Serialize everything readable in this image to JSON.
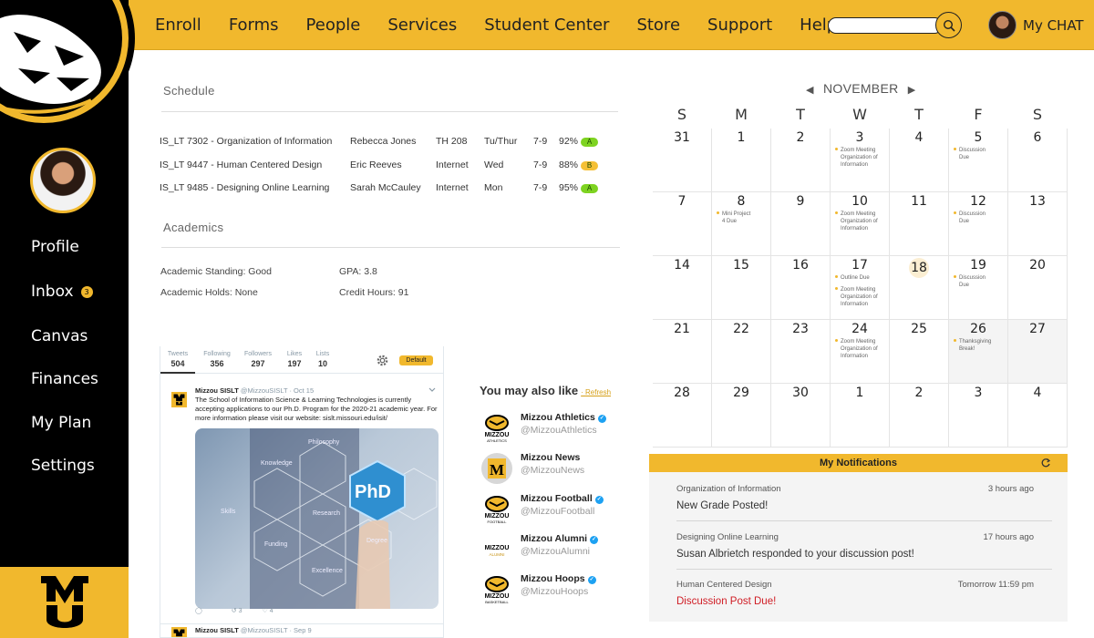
{
  "colors": {
    "gold": "#F1B82D",
    "black": "#000000",
    "alert": "#d01d25",
    "grade_a": "#7ed321",
    "grade_b": "#f5a623"
  },
  "topnav": {
    "items": [
      "Enroll",
      "Forms",
      "People",
      "Services",
      "Student Center",
      "Store",
      "Support",
      "Help"
    ],
    "search_placeholder": "",
    "chat_label": "My CHAT"
  },
  "sidebar": {
    "items": [
      {
        "label": "Profile"
      },
      {
        "label": "Inbox",
        "badge": "3"
      },
      {
        "label": "Canvas"
      },
      {
        "label": "Finances"
      },
      {
        "label": "My Plan"
      },
      {
        "label": "Settings"
      }
    ]
  },
  "schedule": {
    "title": "Schedule",
    "rows": [
      {
        "course": "IS_LT 7302 - Organization of Information",
        "instructor": "Rebecca Jones",
        "room": "TH 208",
        "days": "Tu/Thur",
        "time": "7-9",
        "percent": "92%",
        "grade": "A"
      },
      {
        "course": "IS_LT 9447 - Human Centered Design",
        "instructor": "Eric Reeves",
        "room": "Internet",
        "days": "Wed",
        "time": "7-9",
        "percent": "88%",
        "grade": "B"
      },
      {
        "course": "IS_LT 9485 - Designing Online Learning",
        "instructor": "Sarah McCauley",
        "room": "Internet",
        "days": "Mon",
        "time": "7-9",
        "percent": "95%",
        "grade": "A"
      }
    ]
  },
  "academics": {
    "title": "Academics",
    "standing": "Academic Standing: Good",
    "gpa": "GPA: 3.8",
    "holds": "Academic Holds: None",
    "credit_hours": "Credit Hours: 91"
  },
  "twitter": {
    "stats": [
      {
        "label": "Tweets",
        "value": "504"
      },
      {
        "label": "Following",
        "value": "356"
      },
      {
        "label": "Followers",
        "value": "297"
      },
      {
        "label": "Likes",
        "value": "197"
      },
      {
        "label": "Lists",
        "value": "10"
      }
    ],
    "default_badge": "Default",
    "post": {
      "author": "Mizzou SISLT",
      "handle": "@MizzouSISLT · Oct 15",
      "lines": [
        "The School of Information Science & Learning Technologies is currently",
        "accepting applications to our Ph.D. Program for the 2020-21 academic year. For",
        "more information please visit our website: sislt.missouri.edu/isit/"
      ],
      "image_words": [
        "Knowledge",
        "Philosophy",
        "Research",
        "Funding",
        "Degree",
        "Excellence",
        "Skills"
      ],
      "image_center": "PhD",
      "retweets": "3",
      "likes": "4"
    },
    "post2": {
      "author": "Mizzou SISLT",
      "handle": "@MizzouSISLT · Sep 9"
    }
  },
  "you_may_also_like": {
    "title": "You may also like",
    "refresh": "Refresh",
    "accounts": [
      {
        "name": "Mizzou Athletics",
        "handle": "@MizzouAthletics",
        "logo_text": "MIZZOU",
        "logo_sub": "ATHLETICS"
      },
      {
        "name": "Mizzou News",
        "handle": "@MizzouNews",
        "logo_text": "M",
        "logo_sub": ""
      },
      {
        "name": "Mizzou Football",
        "handle": "@MizzouFootball",
        "logo_text": "MIZZOU",
        "logo_sub": "FOOTBALL"
      },
      {
        "name": "Mizzou Alumni",
        "handle": "@MizzouAlumni",
        "logo_text": "MIZZOU",
        "logo_sub": "ALUMNI"
      },
      {
        "name": "Mizzou Hoops",
        "handle": "@MizzouHoops",
        "logo_text": "MIZZOU",
        "logo_sub": "BASKETBALL"
      }
    ]
  },
  "calendar": {
    "month": "NOVEMBER",
    "weekdays": [
      "S",
      "M",
      "T",
      "W",
      "T",
      "F",
      "S"
    ],
    "today": "18",
    "days": [
      {
        "d": "31",
        "events": []
      },
      {
        "d": "1",
        "events": []
      },
      {
        "d": "2",
        "events": []
      },
      {
        "d": "3",
        "events": [
          [
            "Zoom Meeting",
            "Organization of",
            "Information"
          ]
        ]
      },
      {
        "d": "4",
        "events": []
      },
      {
        "d": "5",
        "events": [
          [
            "Discussion",
            "Due"
          ]
        ]
      },
      {
        "d": "6",
        "events": []
      },
      {
        "d": "7",
        "events": []
      },
      {
        "d": "8",
        "events": [
          [
            "Mini Project",
            "4 Due"
          ]
        ]
      },
      {
        "d": "9",
        "events": []
      },
      {
        "d": "10",
        "events": [
          [
            "Zoom Meeting",
            "Organization of",
            "Information"
          ]
        ]
      },
      {
        "d": "11",
        "events": []
      },
      {
        "d": "12",
        "events": [
          [
            "Discussion",
            "Due"
          ]
        ]
      },
      {
        "d": "13",
        "events": []
      },
      {
        "d": "14",
        "events": []
      },
      {
        "d": "15",
        "events": []
      },
      {
        "d": "16",
        "events": []
      },
      {
        "d": "17",
        "events": [
          [
            "Outline Due"
          ],
          [
            "Zoom Meeting",
            "Organization of",
            "Information"
          ]
        ]
      },
      {
        "d": "18",
        "events": []
      },
      {
        "d": "19",
        "events": [
          [
            "Discussion",
            "Due"
          ]
        ]
      },
      {
        "d": "20",
        "events": []
      },
      {
        "d": "21",
        "events": []
      },
      {
        "d": "22",
        "events": []
      },
      {
        "d": "23",
        "events": []
      },
      {
        "d": "24",
        "events": [
          [
            "Zoom Meeting",
            "Organization of",
            "Information"
          ]
        ]
      },
      {
        "d": "25",
        "events": []
      },
      {
        "d": "26",
        "events": [
          [
            "Thanksgiving",
            "Break!"
          ]
        ],
        "gray": true
      },
      {
        "d": "27",
        "events": [],
        "gray": true
      },
      {
        "d": "28",
        "events": []
      },
      {
        "d": "29",
        "events": []
      },
      {
        "d": "30",
        "events": []
      },
      {
        "d": "1",
        "events": []
      },
      {
        "d": "2",
        "events": []
      },
      {
        "d": "3",
        "events": []
      },
      {
        "d": "4",
        "events": []
      }
    ]
  },
  "notifications": {
    "title": "My Notifications",
    "items": [
      {
        "course": "Organization of Information",
        "time": "3 hours ago",
        "message": "New Grade Posted!",
        "alert": false
      },
      {
        "course": "Designing Online Learning",
        "time": "17 hours ago",
        "message": "Susan Albrietch responded to your discussion post!",
        "alert": false
      },
      {
        "course": "Human Centered Design",
        "time": "Tomorrow 11:59 pm",
        "message": "Discussion Post Due!",
        "alert": true
      }
    ]
  }
}
